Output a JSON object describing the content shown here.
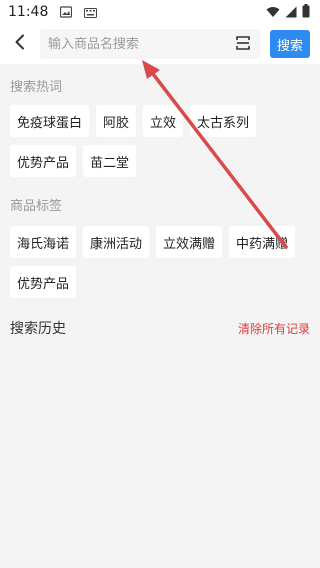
{
  "status_bar": {
    "time": "11:48"
  },
  "search": {
    "placeholder": "输入商品名搜索",
    "button_label": "搜索"
  },
  "hot_search": {
    "title": "搜索热词",
    "tags": [
      "免疫球蛋白",
      "阿胶",
      "立效",
      "太古系列",
      "优势产品",
      "苗二堂"
    ]
  },
  "product_tags": {
    "title": "商品标签",
    "tags": [
      "海氏海诺",
      "康洲活动",
      "立效满赠",
      "中药满赠",
      "优势产品"
    ]
  },
  "history": {
    "title": "搜索历史",
    "clear_label": "清除所有记录"
  },
  "colors": {
    "accent": "#2e8cf0",
    "danger": "#e03a3a",
    "annotation_arrow": "#d94a4a"
  },
  "icons": [
    "gallery-icon",
    "keyboard-icon",
    "wifi-icon",
    "signal-icon",
    "battery-icon",
    "back-arrow-icon",
    "scan-icon"
  ]
}
